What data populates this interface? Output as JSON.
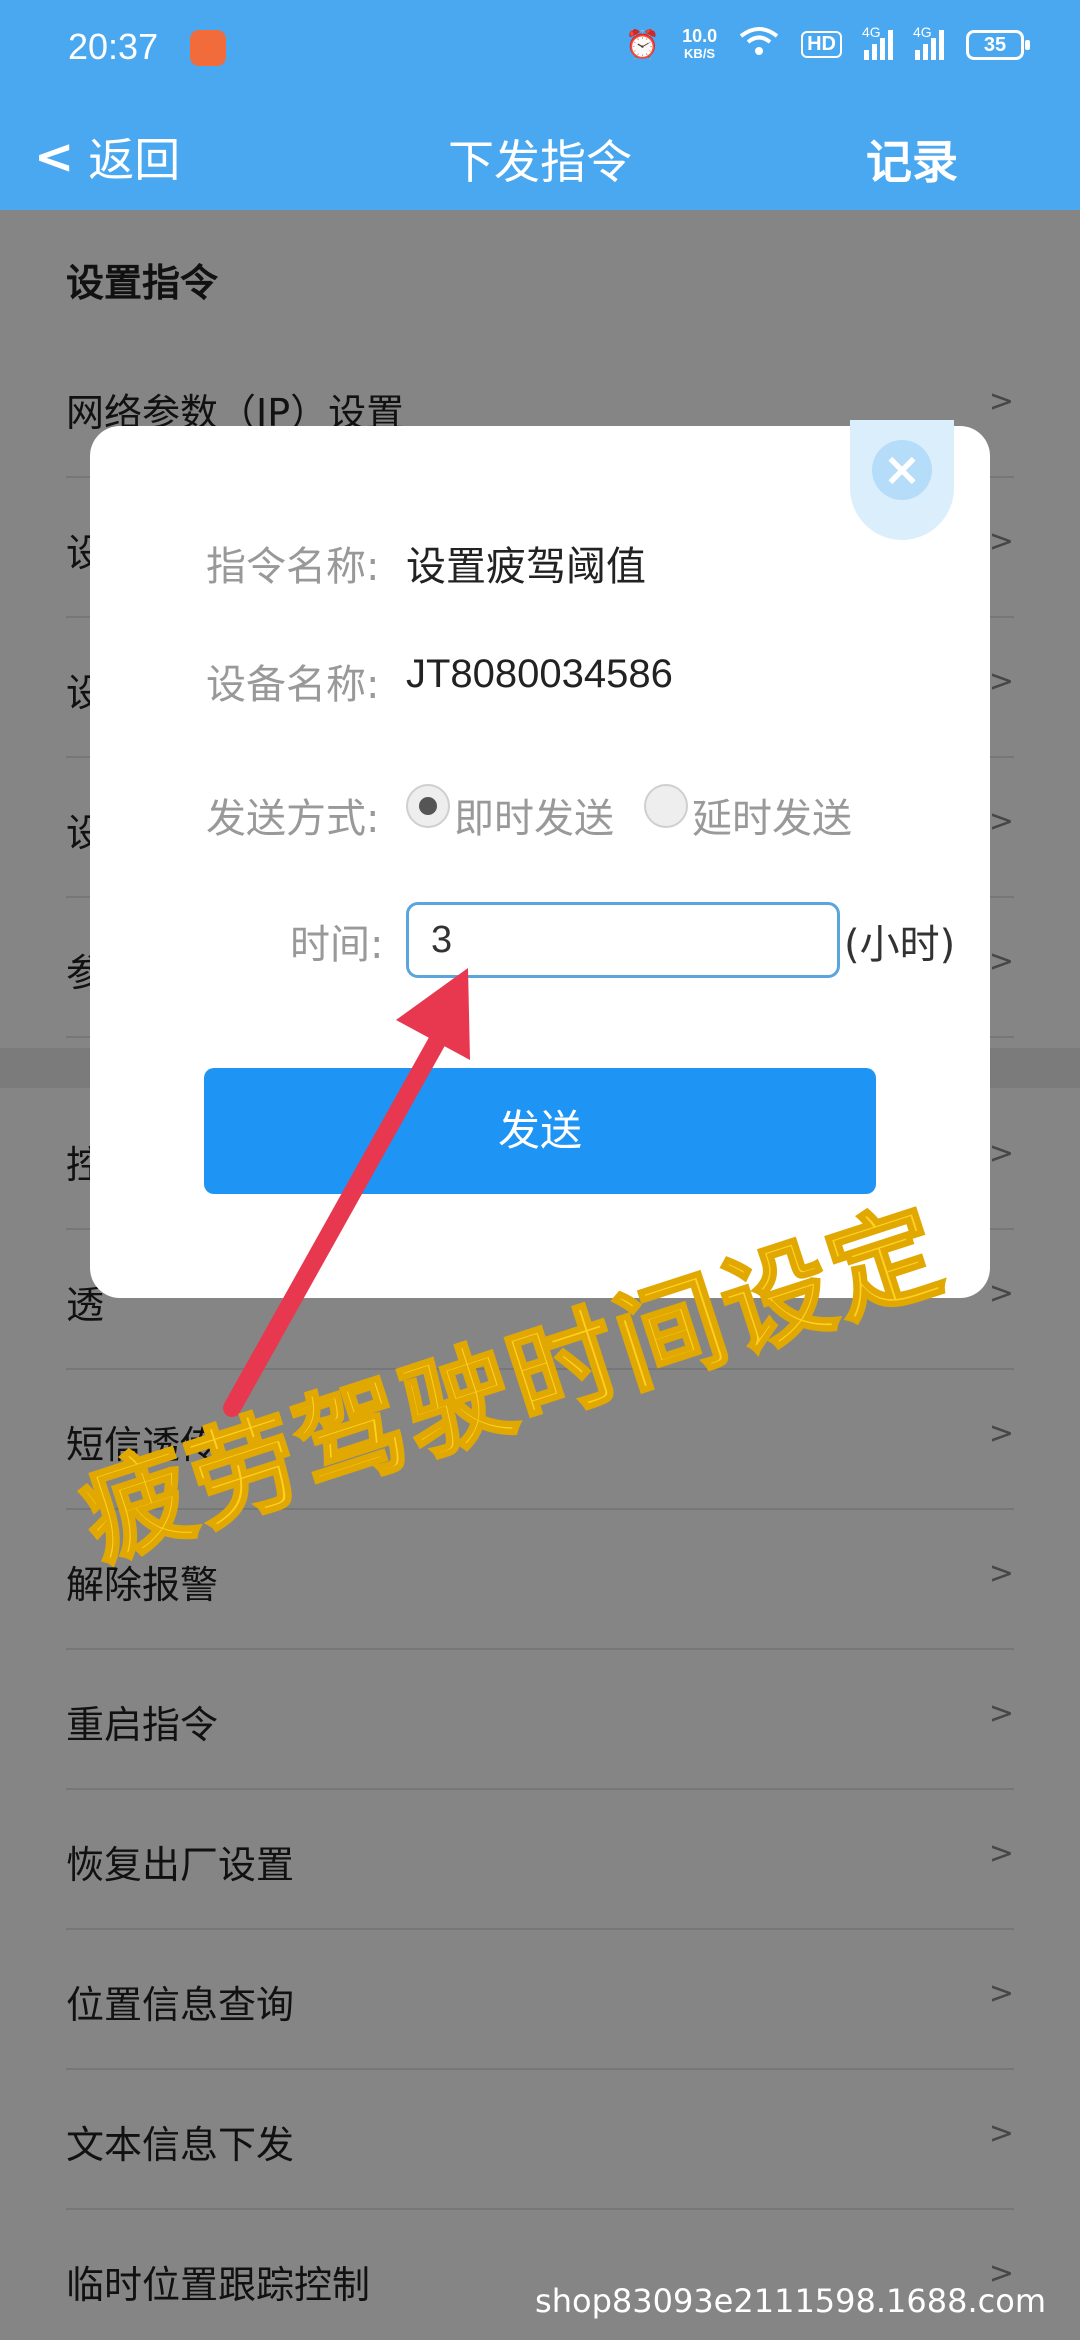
{
  "status_bar": {
    "time": "20:37",
    "net_speed_value": "10.0",
    "net_speed_unit": "KB/S",
    "hd_label": "HD",
    "signal1_label": "4G",
    "signal2_label": "4G",
    "battery": "35"
  },
  "navbar": {
    "back_label": "返回",
    "title": "下发指令",
    "record_label": "记录"
  },
  "list": {
    "section_title": "设置指令",
    "items_top": [
      {
        "label": "网络参数（IP）设置"
      },
      {
        "label": "设"
      },
      {
        "label": "设"
      },
      {
        "label": "设"
      },
      {
        "label": "参"
      }
    ],
    "items_bottom": [
      {
        "label": "控"
      },
      {
        "label": "透"
      },
      {
        "label": "短信透传"
      },
      {
        "label": "解除报警"
      },
      {
        "label": "重启指令"
      },
      {
        "label": "恢复出厂设置"
      },
      {
        "label": "位置信息查询"
      },
      {
        "label": "文本信息下发"
      },
      {
        "label": "临时位置跟踪控制"
      }
    ],
    "chevron": ">"
  },
  "dialog": {
    "command_name_key": "指令名称:",
    "command_name_value": "设置疲驾阈值",
    "device_name_key": "设备名称:",
    "device_name_value": "JT8080034586",
    "send_mode_key": "发送方式:",
    "send_mode_options": [
      "即时发送",
      "延时发送"
    ],
    "send_mode_selected": "即时发送",
    "time_key": "时间:",
    "time_value": "3",
    "time_unit": "(小时)",
    "send_button": "发送",
    "close_icon": "close-icon"
  },
  "annotation": {
    "text": "疲劳驾驶时间设定",
    "arrow_color": "#e8384f",
    "text_color": "#ffcf24"
  },
  "watermark": "shop83093e2111598.1688.com"
}
